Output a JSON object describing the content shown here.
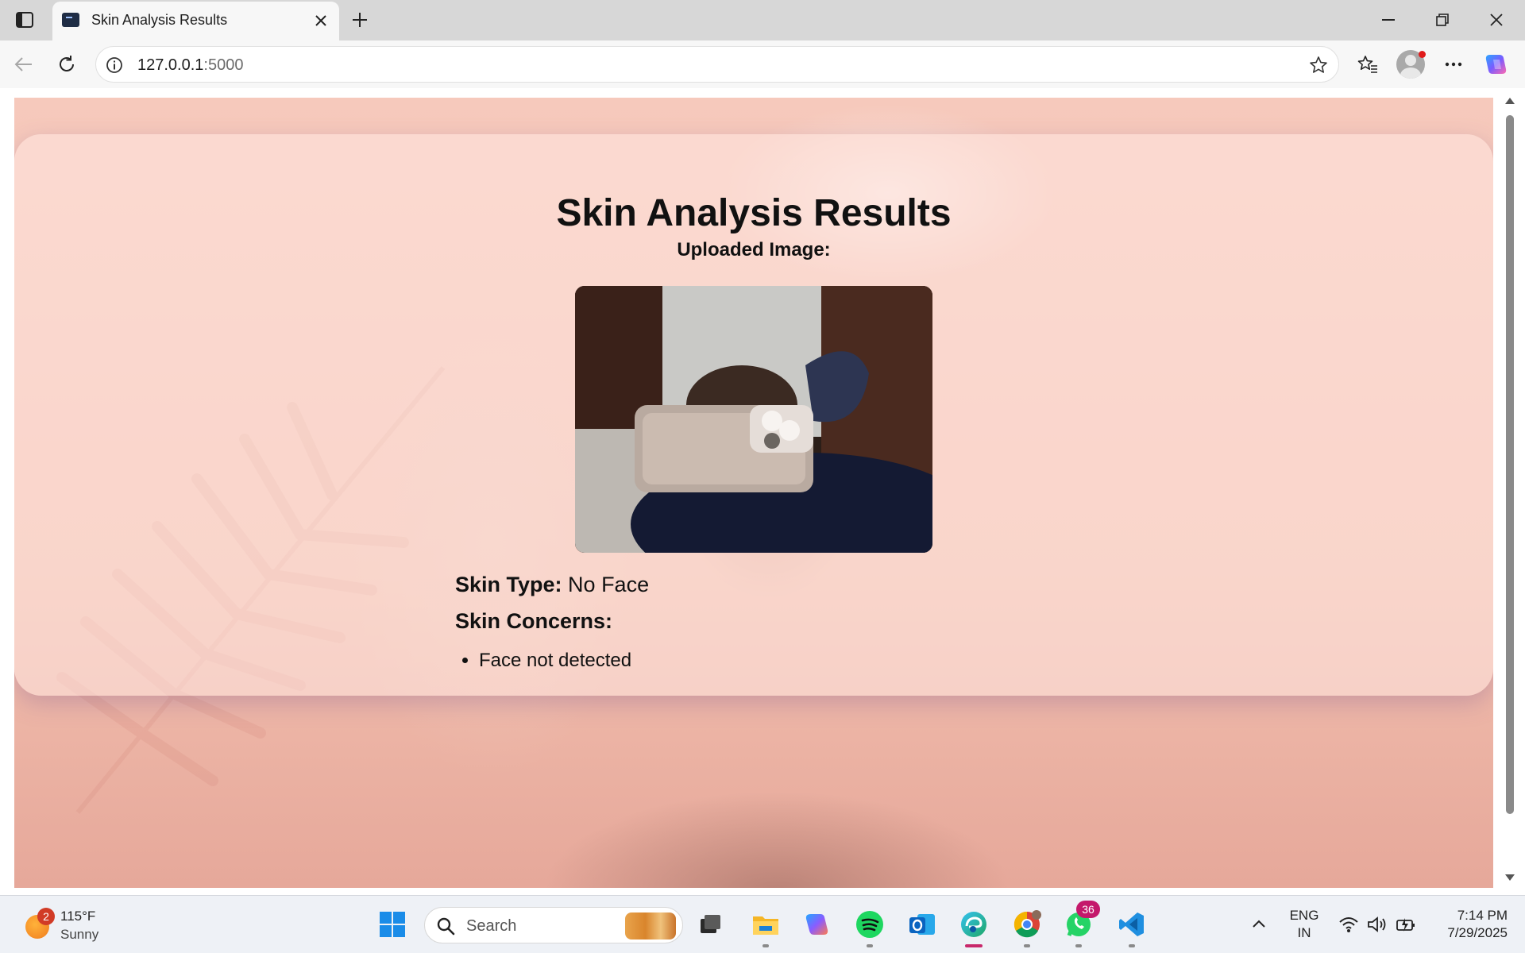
{
  "browser": {
    "tab_title": "Skin Analysis Results",
    "url_host": "127.0.0.1",
    "url_port": ":5000"
  },
  "page": {
    "title": "Skin Analysis Results",
    "uploaded_label": "Uploaded Image:",
    "skin_type_label": "Skin Type:",
    "skin_type_value": "No Face",
    "concerns_label": "Skin Concerns:",
    "concerns": [
      "Face not detected"
    ]
  },
  "taskbar": {
    "weather_badge": "2",
    "weather_temp": "115°F",
    "weather_condition": "Sunny",
    "search_placeholder": "Search",
    "whatsapp_badge": "36",
    "language_line1": "ENG",
    "language_line2": "IN",
    "time": "7:14 PM",
    "date": "7/29/2025"
  },
  "colors": {
    "accent": "#c8286b",
    "page_background": "#f6c9bc",
    "taskbar": "#eef1f6"
  },
  "icons": [
    "tab-actions-icon",
    "terminal-favicon-icon",
    "close-icon",
    "plus-icon",
    "minimize-icon",
    "restore-icon",
    "window-close-icon",
    "back-icon",
    "refresh-icon",
    "info-icon",
    "star-icon",
    "favorites-icon",
    "more-icon",
    "copilot-icon",
    "windows-start-icon",
    "search-icon",
    "task-view-icon",
    "file-explorer-icon",
    "copilot-app-icon",
    "spotify-icon",
    "outlook-icon",
    "edge-icon",
    "chrome-icon",
    "whatsapp-icon",
    "vscode-icon",
    "chevron-up-icon",
    "wifi-icon",
    "volume-icon",
    "battery-icon"
  ]
}
